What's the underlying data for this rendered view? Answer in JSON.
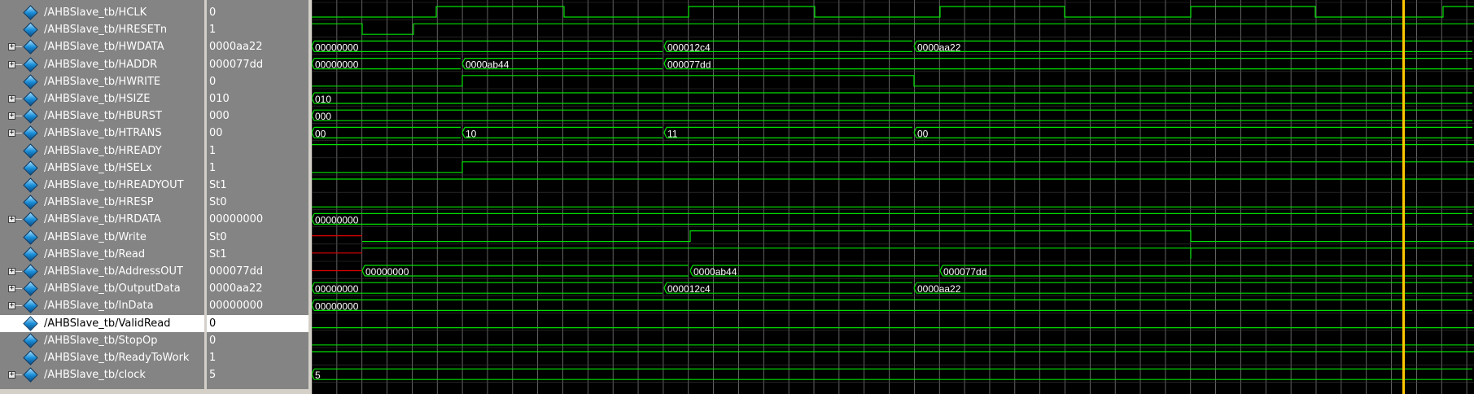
{
  "signals": [
    {
      "name": "/AHBSlave_tb/HCLK",
      "value": "0",
      "expandable": false
    },
    {
      "name": "/AHBSlave_tb/HRESETn",
      "value": "1",
      "expandable": false
    },
    {
      "name": "/AHBSlave_tb/HWDATA",
      "value": "0000aa22",
      "expandable": true
    },
    {
      "name": "/AHBSlave_tb/HADDR",
      "value": "000077dd",
      "expandable": true
    },
    {
      "name": "/AHBSlave_tb/HWRITE",
      "value": "0",
      "expandable": false
    },
    {
      "name": "/AHBSlave_tb/HSIZE",
      "value": "010",
      "expandable": true
    },
    {
      "name": "/AHBSlave_tb/HBURST",
      "value": "000",
      "expandable": true
    },
    {
      "name": "/AHBSlave_tb/HTRANS",
      "value": "00",
      "expandable": true
    },
    {
      "name": "/AHBSlave_tb/HREADY",
      "value": "1",
      "expandable": false
    },
    {
      "name": "/AHBSlave_tb/HSELx",
      "value": "1",
      "expandable": false
    },
    {
      "name": "/AHBSlave_tb/HREADYOUT",
      "value": "St1",
      "expandable": false
    },
    {
      "name": "/AHBSlave_tb/HRESP",
      "value": "St0",
      "expandable": false
    },
    {
      "name": "/AHBSlave_tb/HRDATA",
      "value": "00000000",
      "expandable": true
    },
    {
      "name": "/AHBSlave_tb/Write",
      "value": "St0",
      "expandable": false
    },
    {
      "name": "/AHBSlave_tb/Read",
      "value": "St1",
      "expandable": false
    },
    {
      "name": "/AHBSlave_tb/AddressOUT",
      "value": "000077dd",
      "expandable": true
    },
    {
      "name": "/AHBSlave_tb/OutputData",
      "value": "0000aa22",
      "expandable": true
    },
    {
      "name": "/AHBSlave_tb/InData",
      "value": "00000000",
      "expandable": true
    },
    {
      "name": "/AHBSlave_tb/ValidRead",
      "value": "0",
      "expandable": false,
      "selected": true
    },
    {
      "name": "/AHBSlave_tb/StopOp",
      "value": "0",
      "expandable": false
    },
    {
      "name": "/AHBSlave_tb/ReadyToWork",
      "value": "1",
      "expandable": false
    },
    {
      "name": "/AHBSlave_tb/clock",
      "value": "5",
      "expandable": true
    }
  ],
  "bus_labels": {
    "HWDATA": [
      "00000000",
      "000012c4",
      "0000aa22"
    ],
    "HADDR": [
      "00000000",
      "0000ab44",
      "000077dd"
    ],
    "HSIZE": [
      "010"
    ],
    "HBURST": [
      "000"
    ],
    "HTRANS": [
      "00",
      "10",
      "11",
      "00"
    ],
    "HRDATA": [
      "00000000"
    ],
    "AddressOUT": [
      "00000000",
      "0000ab44",
      "000077dd"
    ],
    "OutputData": [
      "00000000",
      "000012c4",
      "0000aa22"
    ],
    "InData": [
      "00000000"
    ],
    "clock": [
      "5"
    ]
  },
  "colors": {
    "wave": "#00e000",
    "undefined": "#e00000",
    "grid": "#7a7a7a",
    "cursor": "#ffc800",
    "panel": "#848484"
  }
}
